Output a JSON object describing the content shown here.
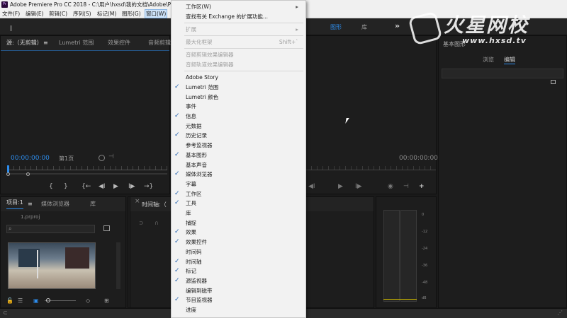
{
  "window": {
    "title": "Adobe Premiere Pro CC 2018 - C:\\用户\\hxsd\\我的文档\\Adobe\\P",
    "app_icon": "Pr"
  },
  "menubar": {
    "items": [
      "文件(F)",
      "编辑(E)",
      "剪辑(C)",
      "序列(S)",
      "标记(M)",
      "图形(G)",
      "窗口(W)"
    ]
  },
  "source_panel": {
    "tabs": [
      "源:（无剪辑）",
      "Lumetri 范围",
      "效果控件",
      "音频剪辑"
    ],
    "timecode": "00:00:00:00",
    "page": "第1页"
  },
  "program_panel": {
    "tabs": [
      "图形",
      "库"
    ],
    "timecode": "00:00:00:00"
  },
  "graphics_panel": {
    "title": "基本图形",
    "tabs": [
      "浏览",
      "编辑"
    ]
  },
  "project_panel": {
    "tabs": [
      "项目:1",
      "媒体浏览器",
      "库"
    ],
    "file": "1.prproj"
  },
  "timeline_panel": {
    "tab": "时间轴:（"
  },
  "audio_meter": {
    "scale": [
      "0",
      "-12",
      "-24",
      "-36",
      "-48",
      "dB"
    ]
  },
  "window_menu": {
    "items": [
      {
        "label": "工作区(W)",
        "submenu": true,
        "checked": false,
        "disabled": false
      },
      {
        "label": "查找有关 Exchange 的扩展功能...",
        "checked": false,
        "disabled": false
      },
      {
        "separator": true
      },
      {
        "label": "扩展",
        "submenu": true,
        "checked": false,
        "disabled": true
      },
      {
        "separator": true
      },
      {
        "label": "最大化框架",
        "shortcut": "Shift+`",
        "checked": false,
        "disabled": true
      },
      {
        "separator": true
      },
      {
        "label": "音频剪辑效果编辑器",
        "checked": false,
        "disabled": true
      },
      {
        "label": "音频轨道效果编辑器",
        "checked": false,
        "disabled": true
      },
      {
        "separator": true
      },
      {
        "label": "Adobe Story",
        "checked": false,
        "disabled": false
      },
      {
        "label": "Lumetri 范围",
        "checked": true,
        "disabled": false
      },
      {
        "label": "Lumetri 颜色",
        "checked": false,
        "disabled": false
      },
      {
        "label": "事件",
        "checked": false,
        "disabled": false
      },
      {
        "label": "信息",
        "checked": true,
        "disabled": false
      },
      {
        "label": "元数据",
        "checked": false,
        "disabled": false
      },
      {
        "label": "历史记录",
        "checked": true,
        "disabled": false
      },
      {
        "label": "参考监视器",
        "checked": false,
        "disabled": false
      },
      {
        "label": "基本图形",
        "checked": true,
        "disabled": false
      },
      {
        "label": "基本声音",
        "checked": false,
        "disabled": false
      },
      {
        "label": "媒体浏览器",
        "checked": true,
        "disabled": false
      },
      {
        "label": "字幕",
        "checked": false,
        "disabled": false
      },
      {
        "label": "工作区",
        "checked": true,
        "disabled": false
      },
      {
        "label": "工具",
        "checked": true,
        "disabled": false
      },
      {
        "label": "库",
        "checked": false,
        "disabled": false
      },
      {
        "label": "捕捉",
        "checked": false,
        "disabled": false
      },
      {
        "label": "效果",
        "checked": true,
        "disabled": false
      },
      {
        "label": "效果控件",
        "checked": true,
        "disabled": false
      },
      {
        "label": "时间码",
        "checked": false,
        "disabled": false
      },
      {
        "label": "时间轴",
        "checked": true,
        "disabled": false
      },
      {
        "label": "标记",
        "checked": true,
        "disabled": false
      },
      {
        "label": "源监视器",
        "checked": true,
        "disabled": false
      },
      {
        "label": "编辑到磁带",
        "checked": false,
        "disabled": false
      },
      {
        "label": "节目监视器",
        "checked": true,
        "disabled": false
      },
      {
        "label": "进度",
        "checked": false,
        "disabled": false
      }
    ]
  },
  "watermark": {
    "big": "火星网校",
    "small": "www.hxsd.tv"
  },
  "colors": {
    "accent": "#2d8ceb",
    "panel_bg": "#1d1d1d",
    "menu_bg": "#f2f2f2"
  }
}
